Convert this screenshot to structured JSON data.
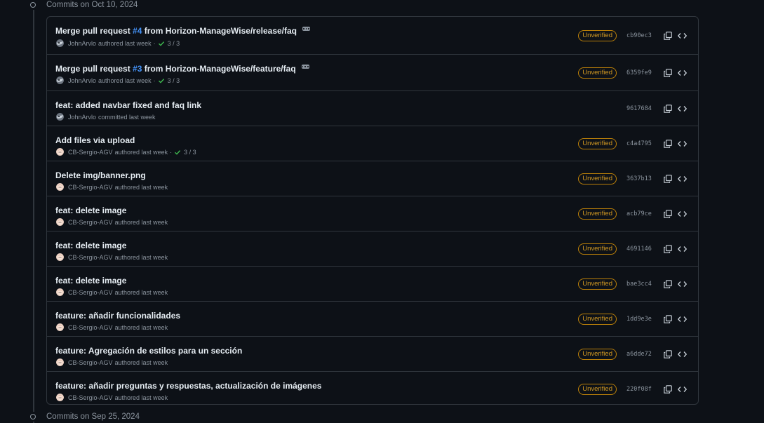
{
  "groups": [
    {
      "title": "Commits on Oct 10, 2024"
    },
    {
      "title": "Commits on Sep 25, 2024"
    }
  ],
  "colors": {
    "background": "#0d1117",
    "border": "#30363d",
    "muted": "#8b949e",
    "link": "#4493f8",
    "unverified": "#d29922",
    "success": "#3fb950"
  },
  "commits": [
    {
      "title_pre": "Merge pull request ",
      "pr": "#4",
      "title_post": " from Horizon-ManageWise/release/faq",
      "has_ellipsis": true,
      "author": "JohnArvlo",
      "verb": "authored last week",
      "sep": "·",
      "checks": "3 / 3",
      "badge": "Unverified",
      "sha": "cb90ec3",
      "avatar": "john"
    },
    {
      "title_pre": "Merge pull request ",
      "pr": "#3",
      "title_post": " from Horizon-ManageWise/feature/faq",
      "has_ellipsis": true,
      "author": "JohnArvlo",
      "verb": "authored last week",
      "sep": "·",
      "checks": "3 / 3",
      "badge": "Unverified",
      "sha": "6359fe9",
      "avatar": "john"
    },
    {
      "title_pre": "feat: added navbar fixed and faq link",
      "pr": "",
      "title_post": "",
      "has_ellipsis": false,
      "author": "JohnArvlo",
      "verb": "committed last week",
      "sep": "",
      "checks": "",
      "badge": "",
      "sha": "9617684",
      "avatar": "john"
    },
    {
      "title_pre": "Add files via upload",
      "pr": "",
      "title_post": "",
      "has_ellipsis": false,
      "author": "CB-Sergio-AGV",
      "verb": "authored last week",
      "sep": "·",
      "checks": "3 / 3",
      "badge": "Unverified",
      "sha": "c4a4795",
      "avatar": "sergio"
    },
    {
      "title_pre": "Delete img/banner.png",
      "pr": "",
      "title_post": "",
      "has_ellipsis": false,
      "author": "CB-Sergio-AGV",
      "verb": "authored last week",
      "sep": "",
      "checks": "",
      "badge": "Unverified",
      "sha": "3637b13",
      "avatar": "sergio"
    },
    {
      "title_pre": "feat: delete image",
      "pr": "",
      "title_post": "",
      "has_ellipsis": false,
      "author": "CB-Sergio-AGV",
      "verb": "authored last week",
      "sep": "",
      "checks": "",
      "badge": "Unverified",
      "sha": "acb79ce",
      "avatar": "sergio"
    },
    {
      "title_pre": "feat: delete image",
      "pr": "",
      "title_post": "",
      "has_ellipsis": false,
      "author": "CB-Sergio-AGV",
      "verb": "authored last week",
      "sep": "",
      "checks": "",
      "badge": "Unverified",
      "sha": "4691146",
      "avatar": "sergio"
    },
    {
      "title_pre": "feat: delete image",
      "pr": "",
      "title_post": "",
      "has_ellipsis": false,
      "author": "CB-Sergio-AGV",
      "verb": "authored last week",
      "sep": "",
      "checks": "",
      "badge": "Unverified",
      "sha": "bae3cc4",
      "avatar": "sergio"
    },
    {
      "title_pre": "feature: añadir funcionalidades",
      "pr": "",
      "title_post": "",
      "has_ellipsis": false,
      "author": "CB-Sergio-AGV",
      "verb": "authored last week",
      "sep": "",
      "checks": "",
      "badge": "Unverified",
      "sha": "1dd9e3e",
      "avatar": "sergio"
    },
    {
      "title_pre": "feature: Agregación de estilos para un sección",
      "pr": "",
      "title_post": "",
      "has_ellipsis": false,
      "author": "CB-Sergio-AGV",
      "verb": "authored last week",
      "sep": "",
      "checks": "",
      "badge": "Unverified",
      "sha": "a6dde72",
      "avatar": "sergio"
    },
    {
      "title_pre": "feature: añadir preguntas y respuestas, actualización de imágenes",
      "pr": "",
      "title_post": "",
      "has_ellipsis": false,
      "author": "CB-Sergio-AGV",
      "verb": "authored last week",
      "sep": "",
      "checks": "",
      "badge": "Unverified",
      "sha": "220f08f",
      "avatar": "sergio"
    }
  ],
  "icons": {
    "group_node": "git-commit-icon",
    "check": "check-icon",
    "copy": "copy-icon",
    "browse": "code-icon",
    "ellipsis": "kebab-horizontal-icon"
  }
}
